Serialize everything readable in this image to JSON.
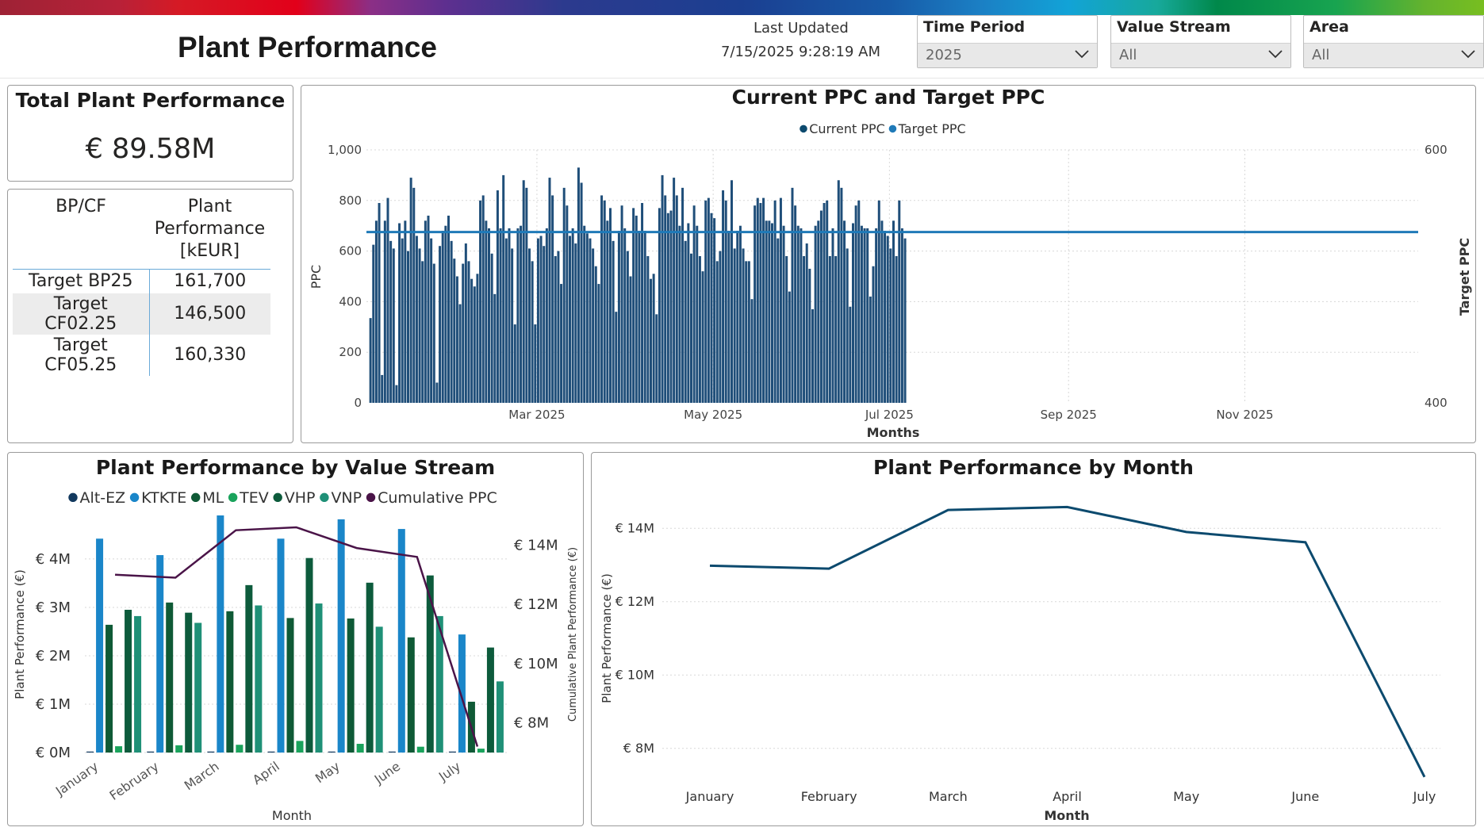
{
  "header": {
    "title": "Plant Performance",
    "last_updated_label": "Last Updated",
    "last_updated_value": "7/15/2025 9:28:19 AM",
    "slicers": [
      {
        "label": "Time Period",
        "value": "2025"
      },
      {
        "label": "Value Stream",
        "value": "All"
      },
      {
        "label": "Area",
        "value": "All"
      }
    ]
  },
  "kpi": {
    "title": "Total Plant Performance",
    "value": "€ 89.58M"
  },
  "bp_table": {
    "headers": [
      "BP/CF",
      "Plant Performance [kEUR]"
    ],
    "rows": [
      [
        "Target BP25",
        "161,700"
      ],
      [
        "Target CF02.25",
        "146,500"
      ],
      [
        "Target CF05.25",
        "160,330"
      ]
    ]
  },
  "colors": {
    "navy": "#0c4a6e",
    "bar_blue": "#1f4e79",
    "target_line": "#1f7ab8",
    "purple": "#4a1448",
    "altez": "#12395e",
    "ktkte": "#1a86c9",
    "ml": "#0f5a36",
    "tev": "#1aa35c",
    "vhp": "#0d5b3c",
    "vnp": "#1f9077"
  },
  "chart_data": [
    {
      "type": "bar",
      "title": "Current PPC and Target PPC",
      "legend": [
        "Current PPC",
        "Target PPC"
      ],
      "legend_position": "top-center",
      "xlabel": "Months",
      "ylabel": "PPC",
      "y2label": "Target PPC",
      "ylim": [
        0,
        1000
      ],
      "y_ticks": [
        "0",
        "200",
        "400",
        "600",
        "800",
        "1,000"
      ],
      "y2lim": [
        400,
        600
      ],
      "y2_ticks": [
        "400",
        "600"
      ],
      "x_ticks": [
        "Mar 2025",
        "May 2025",
        "Jul 2025",
        "Sep 2025",
        "Nov 2025"
      ],
      "x_range": [
        "2025-01-01",
        "2025-12-31"
      ],
      "target_value": 535,
      "grid": true,
      "series": [
        {
          "name": "Current PPC",
          "start_date": "2025-01-02",
          "values": [
            335,
            625,
            720,
            790,
            110,
            720,
            810,
            640,
            610,
            70,
            710,
            650,
            720,
            600,
            890,
            850,
            660,
            610,
            560,
            720,
            740,
            650,
            550,
            80,
            620,
            680,
            700,
            740,
            640,
            570,
            500,
            390,
            550,
            630,
            560,
            490,
            460,
            510,
            800,
            820,
            720,
            690,
            590,
            430,
            840,
            690,
            900,
            650,
            690,
            610,
            310,
            690,
            700,
            880,
            850,
            610,
            560,
            310,
            650,
            660,
            620,
            690,
            890,
            820,
            580,
            600,
            470,
            850,
            780,
            660,
            690,
            630,
            930,
            870,
            700,
            670,
            650,
            610,
            540,
            470,
            820,
            800,
            720,
            770,
            640,
            360,
            680,
            780,
            690,
            600,
            500,
            770,
            740,
            680,
            790,
            680,
            580,
            490,
            510,
            350,
            770,
            900,
            820,
            750,
            760,
            890,
            820,
            700,
            850,
            640,
            710,
            590,
            780,
            700,
            580,
            520,
            800,
            810,
            750,
            730,
            560,
            600,
            840,
            800,
            680,
            880,
            610,
            680,
            700,
            610,
            560,
            560,
            410,
            780,
            810,
            790,
            810,
            720,
            720,
            710,
            800,
            650,
            810,
            700,
            580,
            440,
            850,
            780,
            700,
            690,
            580,
            630,
            530,
            370,
            700,
            720,
            760,
            790,
            800,
            580,
            690,
            580,
            880,
            850,
            720,
            610,
            380,
            710,
            780,
            800,
            700,
            690,
            690,
            420,
            540,
            690,
            800,
            720,
            680,
            660,
            610,
            720,
            580,
            800,
            690,
            650
          ]
        },
        {
          "name": "Target PPC",
          "values": [
            535
          ]
        }
      ]
    },
    {
      "type": "bar",
      "title": "Plant Performance by Value Stream",
      "xlabel": "Month",
      "ylabel": "Plant Performance (€)",
      "y2label": "Cumulative Plant Performance (€)",
      "categories": [
        "January",
        "February",
        "March",
        "April",
        "May",
        "June",
        "July"
      ],
      "ylim": [
        0,
        4.9
      ],
      "y_ticks": [
        "€ 0M",
        "€ 1M",
        "€ 2M",
        "€ 3M",
        "€ 4M"
      ],
      "y2lim": [
        7,
        15
      ],
      "y2_ticks": [
        "€ 8M",
        "€ 10M",
        "€ 12M",
        "€ 14M"
      ],
      "legend_position": "top",
      "series": [
        {
          "name": "Alt-EZ",
          "values": [
            0.02,
            0.02,
            0.02,
            0.02,
            0.02,
            0.02,
            0.02
          ]
        },
        {
          "name": "KTKTE",
          "values": [
            4.42,
            4.08,
            4.9,
            4.42,
            4.82,
            4.62,
            2.44
          ]
        },
        {
          "name": "ML",
          "values": [
            2.64,
            3.1,
            2.92,
            2.78,
            2.77,
            2.38,
            1.05
          ]
        },
        {
          "name": "TEV",
          "values": [
            0.13,
            0.15,
            0.16,
            0.24,
            0.18,
            0.12,
            0.08
          ]
        },
        {
          "name": "VHP",
          "values": [
            2.95,
            2.89,
            3.46,
            4.02,
            3.51,
            3.66,
            2.17
          ]
        },
        {
          "name": "VNP",
          "values": [
            2.82,
            2.68,
            3.04,
            3.08,
            2.6,
            2.82,
            1.47
          ]
        },
        {
          "name": "Cumulative PPC",
          "type": "line",
          "values": [
            13.0,
            12.9,
            14.5,
            14.6,
            13.9,
            13.6,
            7.2
          ]
        }
      ]
    },
    {
      "type": "line",
      "title": "Plant Performance by Month",
      "xlabel": "Month",
      "ylabel": "Plant Performance (€)",
      "categories": [
        "January",
        "February",
        "March",
        "April",
        "May",
        "June",
        "July"
      ],
      "ylim": [
        7,
        15
      ],
      "y_ticks": [
        "€ 8M",
        "€ 10M",
        "€ 12M",
        "€ 14M"
      ],
      "series": [
        {
          "values": [
            12.98,
            12.9,
            14.5,
            14.58,
            13.9,
            13.62,
            7.22
          ]
        }
      ]
    }
  ]
}
